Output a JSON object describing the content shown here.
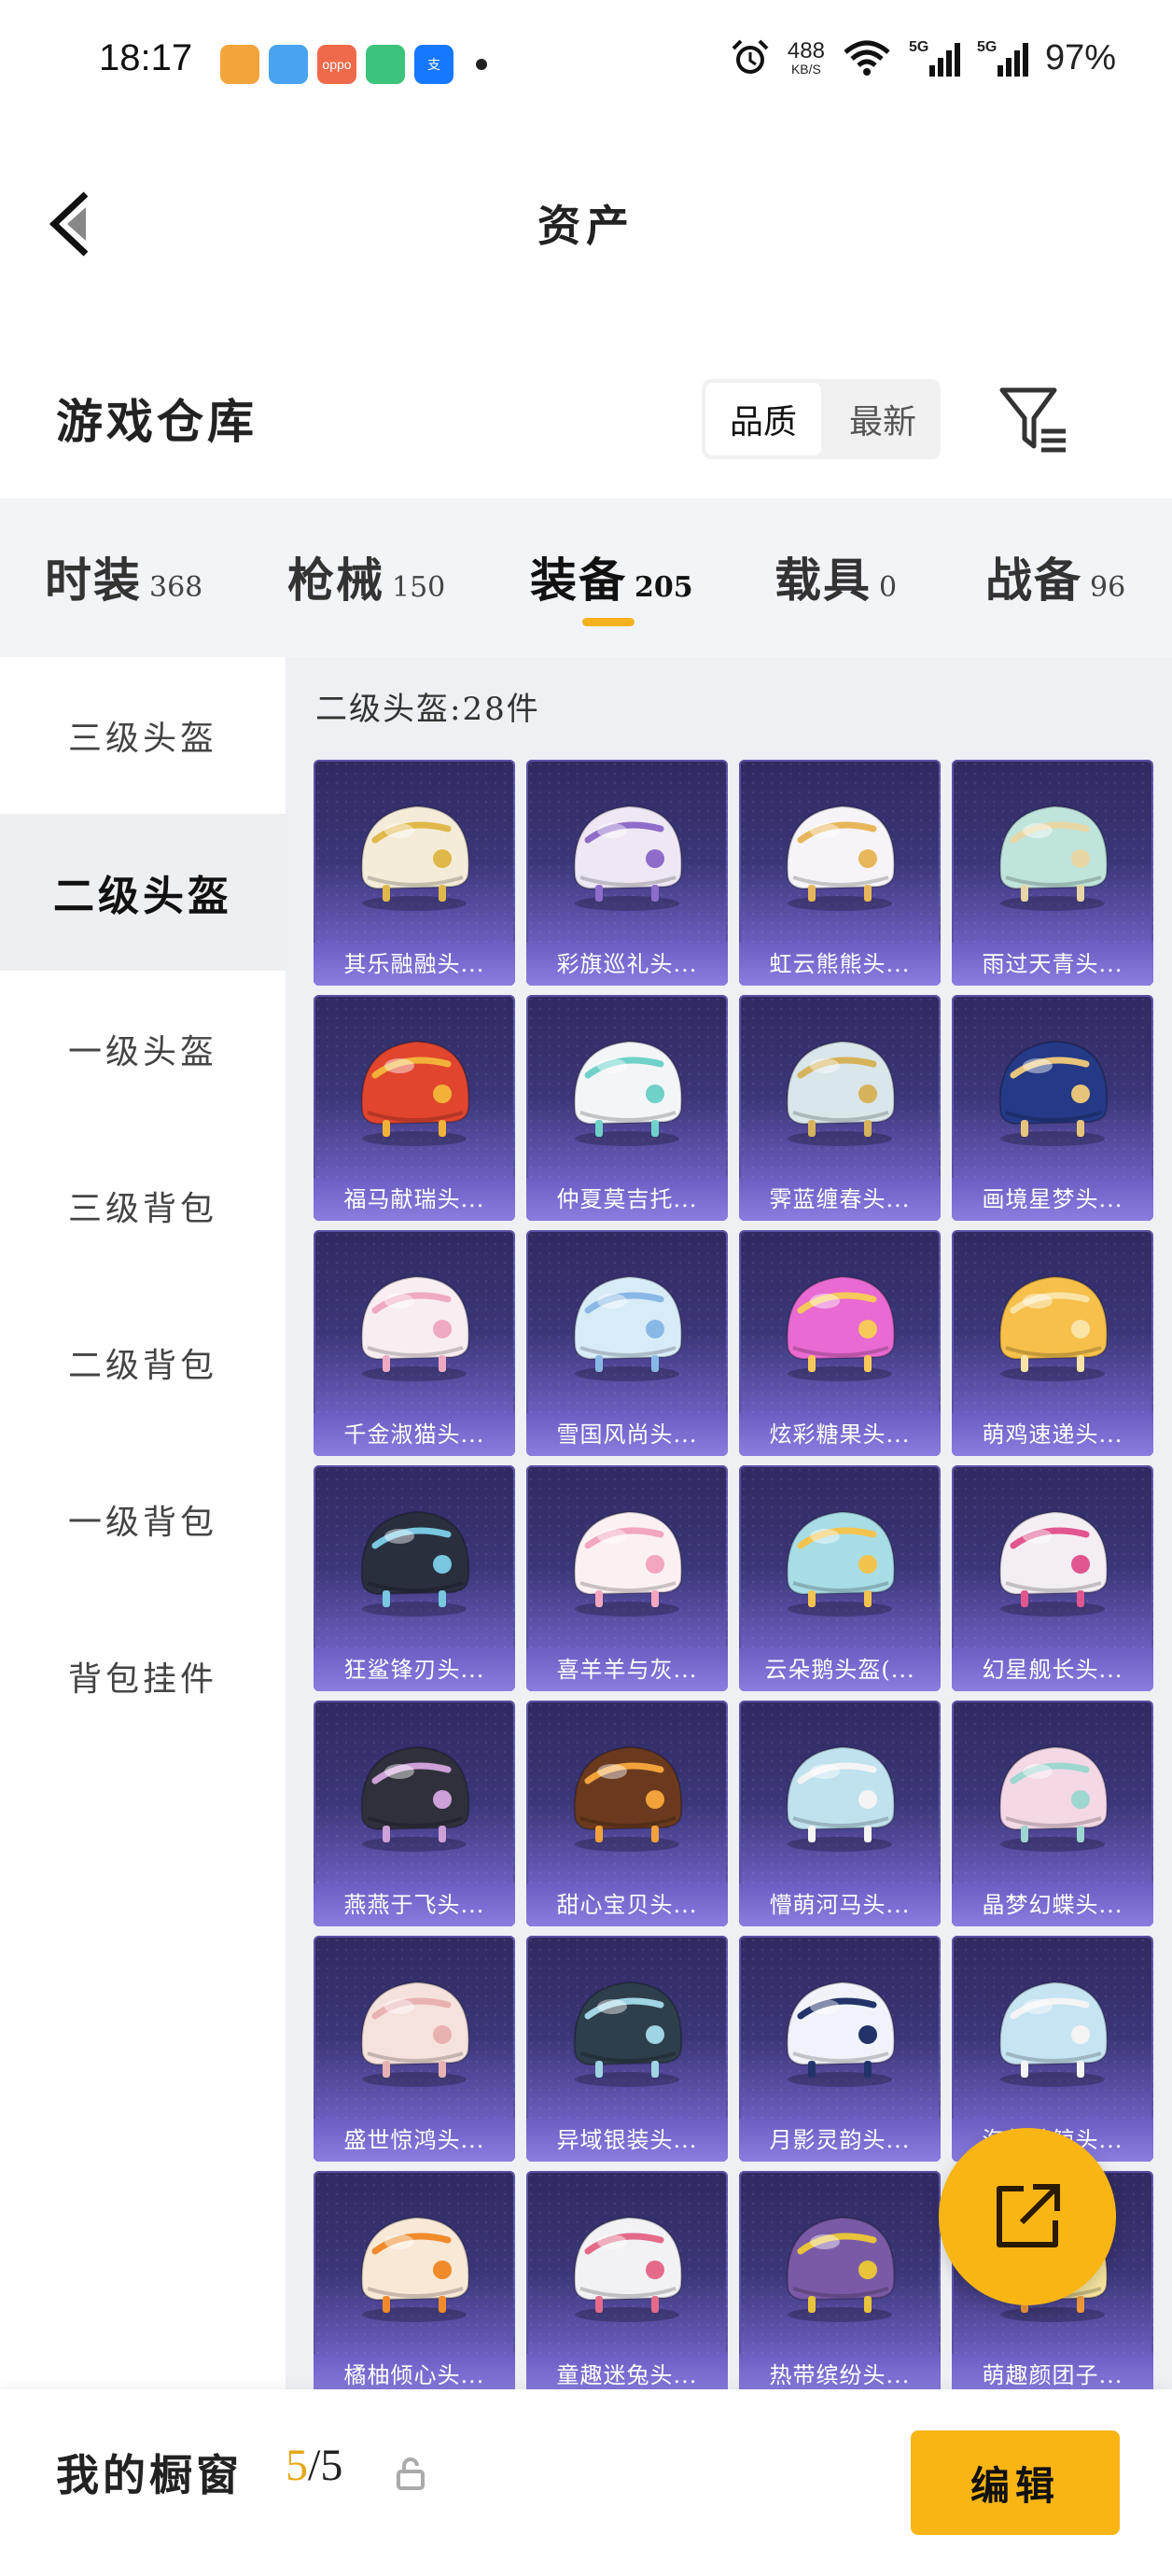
{
  "status_bar": {
    "time": "18:17",
    "net_speed_value": "488",
    "net_speed_unit": "KB/S",
    "signal_1": "5G",
    "signal_2": "5G",
    "battery": "97%",
    "app_icons": [
      {
        "name": "game-app-icon",
        "color": "#f3a43a",
        "text": ""
      },
      {
        "name": "gallery-app-icon",
        "color": "#4aa3f0",
        "text": ""
      },
      {
        "name": "oppo-app-icon",
        "color": "#ef6a4a",
        "text": "oppo"
      },
      {
        "name": "video-app-icon",
        "color": "#3cc47a",
        "text": ""
      },
      {
        "name": "alipay-app-icon",
        "color": "#1677ff",
        "text": "支"
      }
    ]
  },
  "header": {
    "title": "资产"
  },
  "warehouse": {
    "title": "游戏仓库",
    "sort_options": [
      "品质",
      "最新"
    ],
    "active_sort": 0
  },
  "categories": [
    {
      "label": "时装",
      "count": "368"
    },
    {
      "label": "枪械",
      "count": "150"
    },
    {
      "label": "装备",
      "count": "205"
    },
    {
      "label": "载具",
      "count": "0"
    },
    {
      "label": "战备",
      "count": "96"
    }
  ],
  "active_category": 2,
  "subnav": [
    "三级头盔",
    "二级头盔",
    "一级头盔",
    "三级背包",
    "二级背包",
    "一级背包",
    "背包挂件"
  ],
  "active_subnav": 1,
  "grid": {
    "count_label": "二级头盔:28件",
    "items": [
      {
        "name": "其乐融融头...",
        "color": "#f4ecd8",
        "accent": "#e0b84a"
      },
      {
        "name": "彩旗巡礼头...",
        "color": "#efe8f4",
        "accent": "#8e6cc9"
      },
      {
        "name": "虹云熊熊头...",
        "color": "#f6f4f8",
        "accent": "#e8b65a"
      },
      {
        "name": "雨过天青头...",
        "color": "#bfe4dc",
        "accent": "#e8d7a4"
      },
      {
        "name": "福马献瑞头...",
        "color": "#e2452e",
        "accent": "#f2b23a"
      },
      {
        "name": "仲夏莫吉托...",
        "color": "#f2f6f8",
        "accent": "#6fd1c8"
      },
      {
        "name": "霁蓝缠春头...",
        "color": "#d9e6ea",
        "accent": "#d6b35a"
      },
      {
        "name": "画境星梦头...",
        "color": "#243a86",
        "accent": "#e8c47a"
      },
      {
        "name": "千金淑猫头...",
        "color": "#f8eef2",
        "accent": "#f0a9c3"
      },
      {
        "name": "雪国风尚头...",
        "color": "#d8ecf8",
        "accent": "#8ab8e6"
      },
      {
        "name": "炫彩糖果头...",
        "color": "#e86ad2",
        "accent": "#f6c95a"
      },
      {
        "name": "萌鸡速递头...",
        "color": "#f6c04a",
        "accent": "#fbe3a6"
      },
      {
        "name": "狂鲨锋刃头...",
        "color": "#2a2f3e",
        "accent": "#79c7e0"
      },
      {
        "name": "喜羊羊与灰...",
        "color": "#fbf1f3",
        "accent": "#f3a6c0"
      },
      {
        "name": "云朵鹅头盔(...",
        "color": "#a8dde6",
        "accent": "#f2c44e"
      },
      {
        "name": "幻星舰长头...",
        "color": "#f4eef4",
        "accent": "#e1568f"
      },
      {
        "name": "燕燕于飞头...",
        "color": "#30303c",
        "accent": "#cda1d8"
      },
      {
        "name": "甜心宝贝头...",
        "color": "#6b3a1e",
        "accent": "#f2a23a"
      },
      {
        "name": "懵萌河马头...",
        "color": "#bfe2ee",
        "accent": "#f4f4f4"
      },
      {
        "name": "晶梦幻蝶头...",
        "color": "#f4d8e6",
        "accent": "#9ed6d0"
      },
      {
        "name": "盛世惊鸿头...",
        "color": "#f6e2dc",
        "accent": "#e8b2b2"
      },
      {
        "name": "异域银装头...",
        "color": "#2e3e4a",
        "accent": "#9fd4e2"
      },
      {
        "name": "月影灵韵头...",
        "color": "#f0f4fa",
        "accent": "#22336a"
      },
      {
        "name": "海盐萌鲸头...",
        "color": "#c6e4f2",
        "accent": "#f4f4f4"
      },
      {
        "name": "橘柚倾心头...",
        "color": "#f8e8d6",
        "accent": "#f08a2a"
      },
      {
        "name": "童趣迷兔头...",
        "color": "#f2f2f4",
        "accent": "#e46a8a"
      },
      {
        "name": "热带缤纷头...",
        "color": "#7a5aa6",
        "accent": "#e8c43a"
      },
      {
        "name": "萌趣颜团子...",
        "color": "#f8e6a0",
        "accent": "#f29a3a"
      }
    ]
  },
  "bottom_bar": {
    "label": "我的橱窗",
    "current": "5",
    "total": "/5",
    "edit_label": "编辑"
  }
}
